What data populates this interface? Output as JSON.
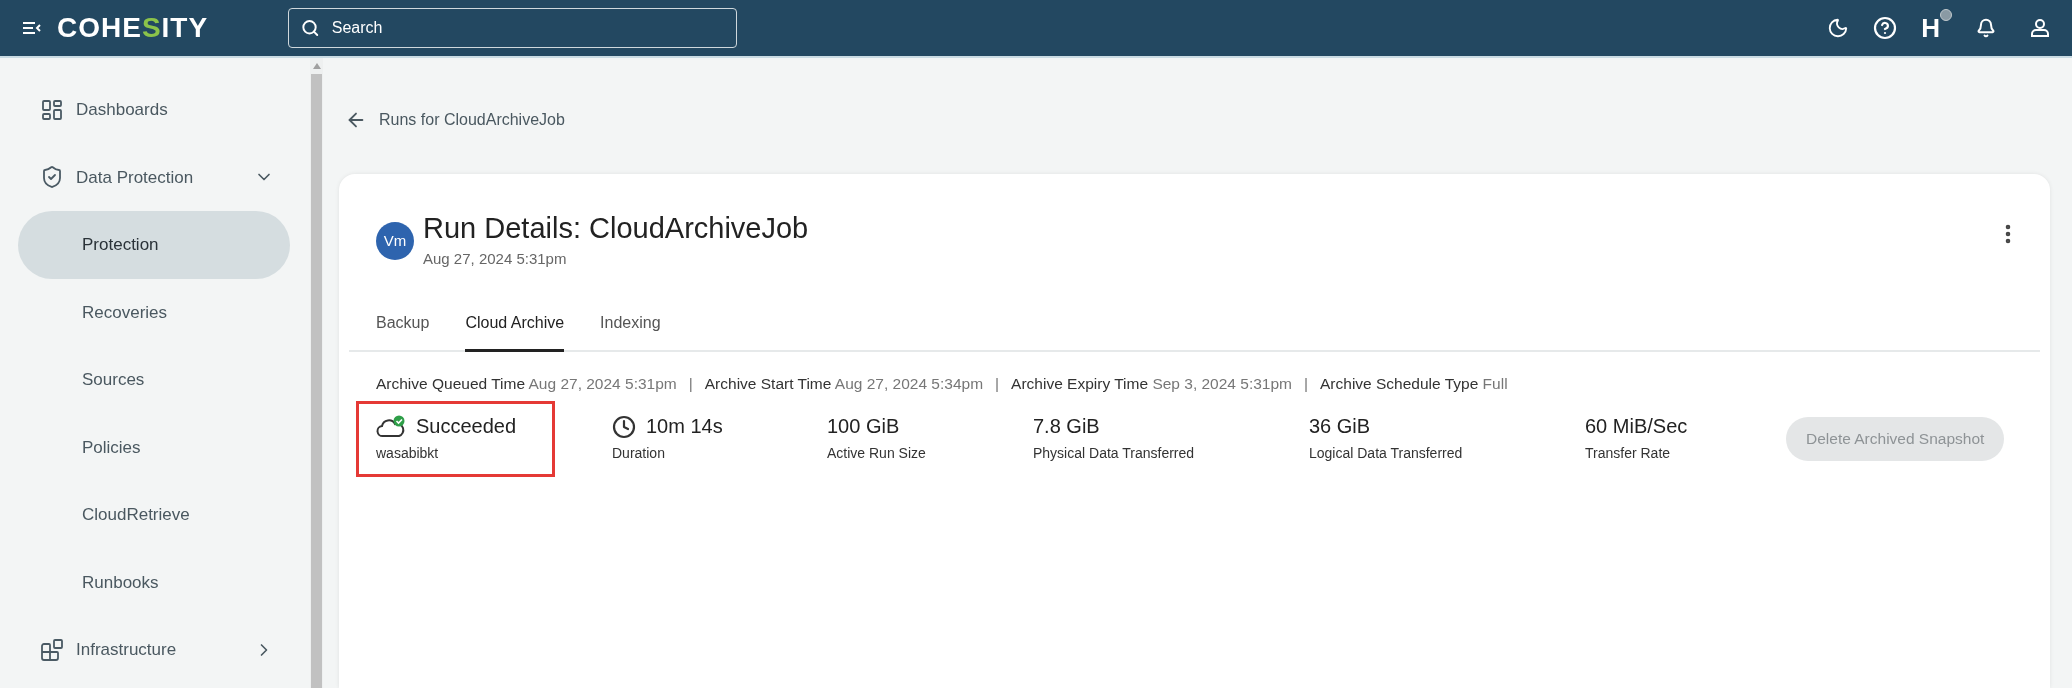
{
  "topbar": {
    "logo": [
      {
        "text": "COHE",
        "accent": false
      },
      {
        "text": "S",
        "accent": true
      },
      {
        "text": "ITY",
        "accent": false
      }
    ],
    "search": {
      "placeholder": "Search"
    },
    "app_letter": "H"
  },
  "sidebar": {
    "items": [
      {
        "label": "Dashboards",
        "selected": false
      },
      {
        "label": "Data Protection",
        "expanded": true,
        "selected": false,
        "children": [
          {
            "label": "Protection",
            "selected": true
          },
          {
            "label": "Recoveries",
            "selected": false
          },
          {
            "label": "Sources",
            "selected": false
          },
          {
            "label": "Policies",
            "selected": false
          },
          {
            "label": "CloudRetrieve",
            "selected": false
          },
          {
            "label": "Runbooks",
            "selected": false
          }
        ]
      },
      {
        "label": "Infrastructure",
        "expanded": false,
        "selected": false
      }
    ]
  },
  "back_link": "Runs for CloudArchiveJob",
  "card": {
    "avatar": "Vm",
    "title": "Run Details: CloudArchiveJob",
    "subtitle": "Aug 27, 2024 5:31pm",
    "tabs": [
      {
        "label": "Backup",
        "selected": false
      },
      {
        "label": "Cloud Archive",
        "selected": true
      },
      {
        "label": "Indexing",
        "selected": false
      }
    ],
    "info": [
      {
        "label": "Archive Queued Time",
        "value": "Aug 27, 2024 5:31pm"
      },
      {
        "separator": "|",
        "label": "Archive Start Time",
        "value": "Aug 27, 2024 5:34pm"
      },
      {
        "separator": "|",
        "label": "Archive Expiry Time",
        "value": "Sep 3, 2024 5:31pm"
      },
      {
        "separator": "|",
        "label": "Archive Schedule Type",
        "value": "Full"
      }
    ],
    "stats": [
      {
        "kind": "status",
        "value": "Succeeded",
        "label": "wasabibkt",
        "highlighted": true
      },
      {
        "kind": "duration",
        "value": "10m 14s",
        "label": "Duration",
        "highlighted": false
      },
      {
        "kind": "plain",
        "value": "100 GiB",
        "label": "Active Run Size",
        "highlighted": false
      },
      {
        "kind": "plain",
        "value": "7.8 GiB",
        "label": "Physical Data Transferred",
        "highlighted": false
      },
      {
        "kind": "plain",
        "value": "36 GiB",
        "label": "Logical Data Transferred",
        "highlighted": false
      },
      {
        "kind": "plain",
        "value": "60 MiB/Sec",
        "label": "Transfer Rate",
        "highlighted": false
      }
    ],
    "action": {
      "label": "Delete Archived Snapshot",
      "disabled": true
    }
  }
}
